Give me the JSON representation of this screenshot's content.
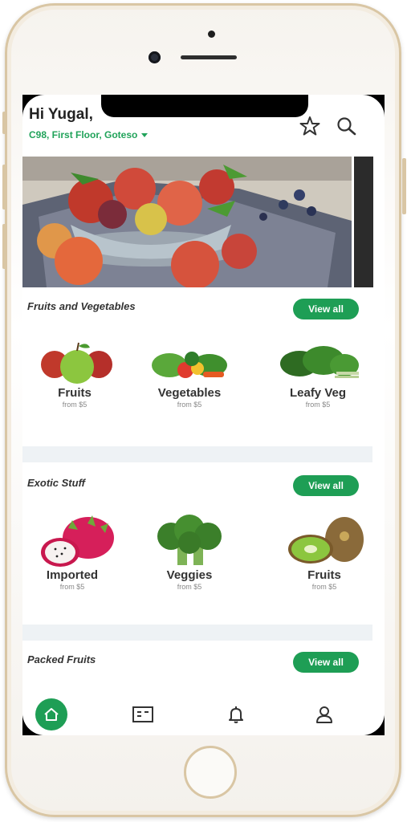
{
  "header": {
    "greeting": "Hi Yugal,",
    "address": "C98, First Floor, Goteso"
  },
  "icons": {
    "favorite": "star-icon",
    "search": "search-icon",
    "address_dropdown": "chevron-down-icon"
  },
  "sections": [
    {
      "title": "Fruits and Vegetables",
      "view_all": "View all",
      "items": [
        {
          "name": "Fruits",
          "price": "from $5"
        },
        {
          "name": "Vegetables",
          "price": "from $5"
        },
        {
          "name": "Leafy Veg",
          "price": "from $5"
        }
      ]
    },
    {
      "title": "Exotic Stuff",
      "view_all": "View all",
      "items": [
        {
          "name": "Imported",
          "price": "from $5"
        },
        {
          "name": "Veggies",
          "price": "from $5"
        },
        {
          "name": "Fruits",
          "price": "from $5"
        }
      ]
    },
    {
      "title": "Packed Fruits",
      "view_all": "View all"
    }
  ],
  "bottom_nav": [
    "home-icon",
    "menu-icon",
    "bell-icon",
    "user-icon"
  ],
  "colors": {
    "accent": "#1e9e55",
    "address": "#21a35a",
    "divider": "#eef2f5"
  }
}
